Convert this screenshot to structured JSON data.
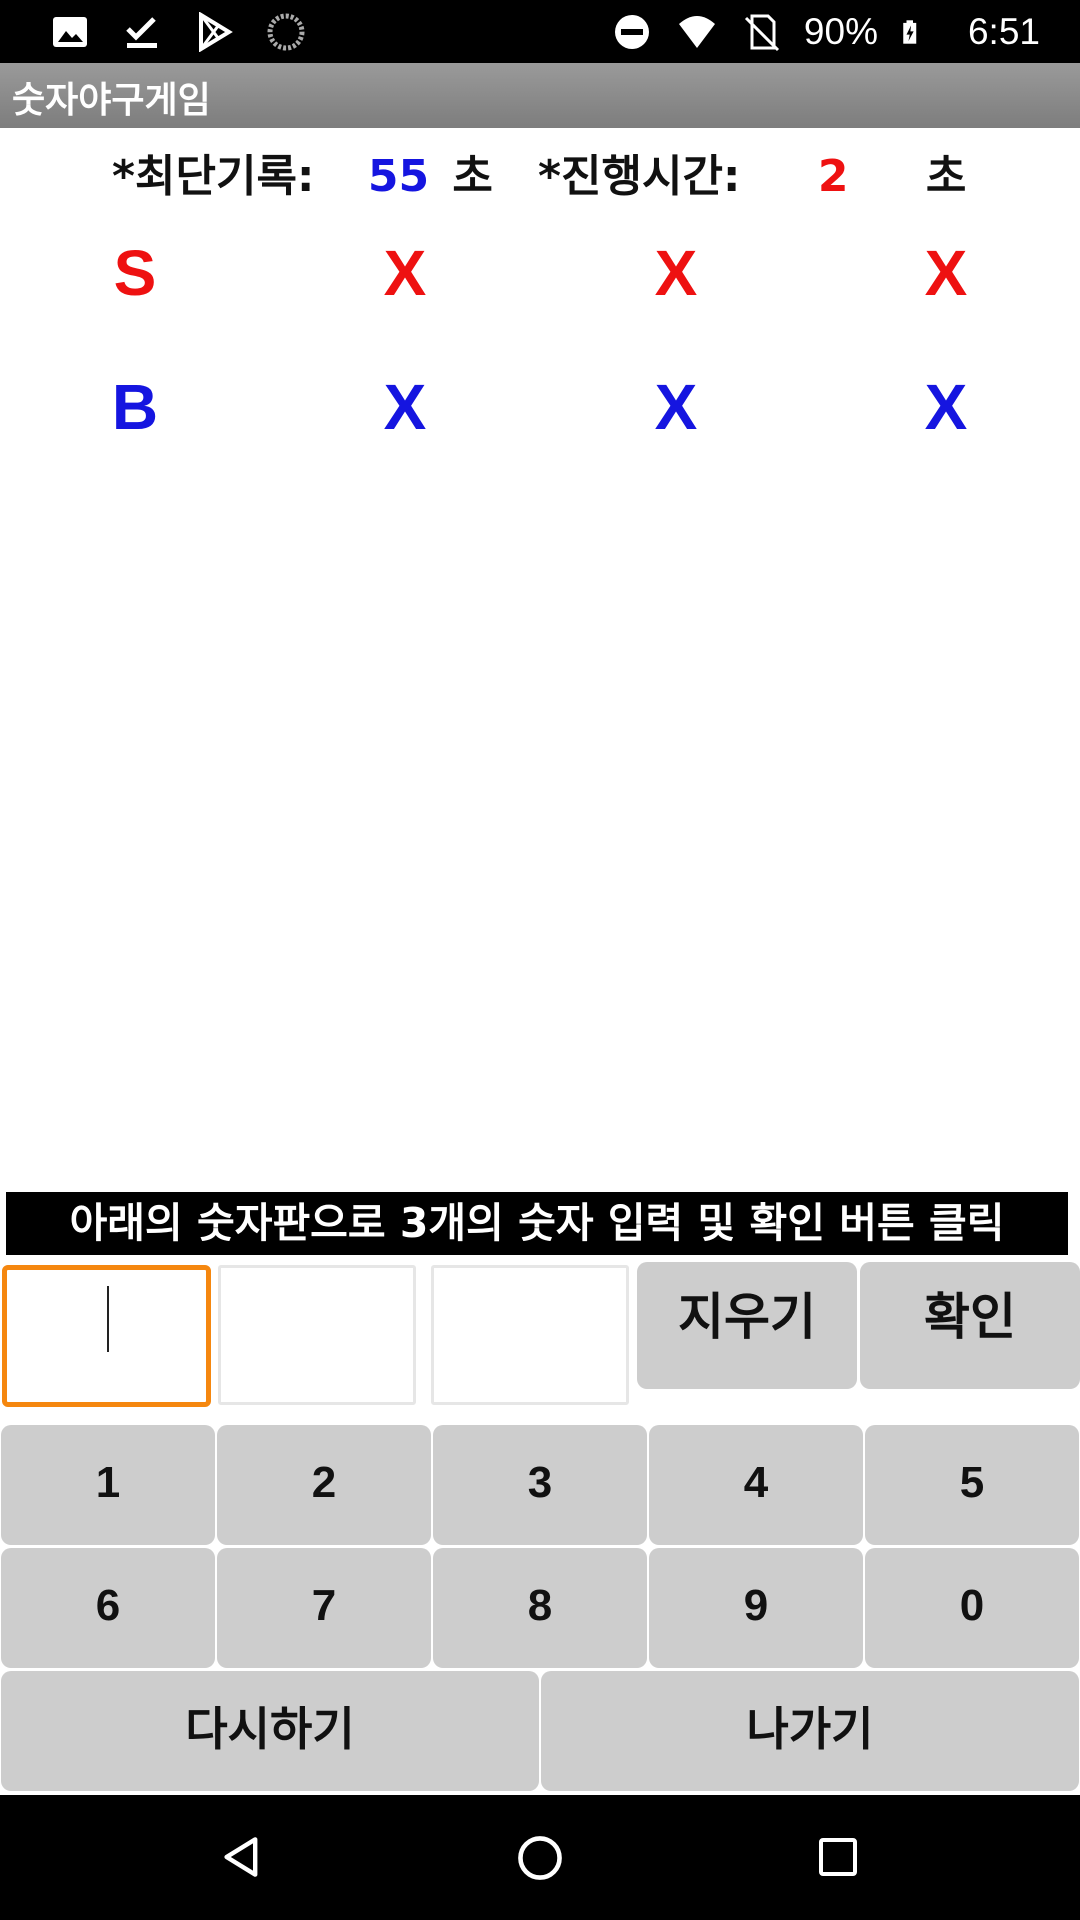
{
  "status_bar": {
    "battery": "90%",
    "time": "6:51",
    "left_icons": [
      "gallery-icon",
      "download-done-icon",
      "play-store-icon",
      "sync-icon"
    ],
    "right_icons": [
      "dnd-icon",
      "wifi-icon",
      "no-sim-icon",
      "battery-charging-icon"
    ]
  },
  "app": {
    "title": "숫자야구게임"
  },
  "records": {
    "best_label": "*최단기록:",
    "best_value": "55",
    "best_unit": "초",
    "time_label": "*진행시간:",
    "time_value": "2",
    "time_unit": "초"
  },
  "strike_row": {
    "label": "S",
    "marks": [
      "X",
      "X",
      "X"
    ]
  },
  "ball_row": {
    "label": "B",
    "marks": [
      "X",
      "X",
      "X"
    ]
  },
  "instruction": "아래의 숫자판으로 3개의 숫자 입력 및 확인 버튼 클릭",
  "inputs": [
    {
      "value": "",
      "focused": true
    },
    {
      "value": "",
      "focused": false
    },
    {
      "value": "",
      "focused": false
    }
  ],
  "actions": {
    "clear": "지우기",
    "confirm": "확인"
  },
  "keypad": {
    "row1": [
      "1",
      "2",
      "3",
      "4",
      "5"
    ],
    "row2": [
      "6",
      "7",
      "8",
      "9",
      "0"
    ]
  },
  "bottom": {
    "restart": "다시하기",
    "exit": "나가기"
  },
  "colors": {
    "strike": "#ee1111",
    "ball": "#1515e0",
    "focus_border": "#f5870f",
    "button_bg": "#cdcdcd"
  }
}
